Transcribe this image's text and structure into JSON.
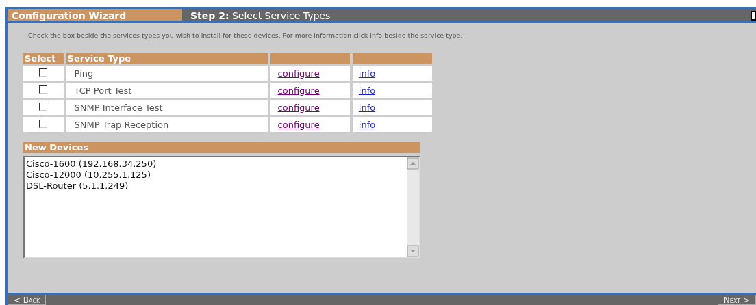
{
  "window": {
    "title": "Configuration Wizard",
    "step": "**Step 2:** Select Service Types"
  },
  "instructions": "Check the box beside the services types you wish to install for these devices. For more information click info beside the service type.",
  "table": {
    "columns": [
      "Select",
      "Service Type"
    ],
    "rows": [
      {
        "checked": false,
        "service": "Ping",
        "configure": "configure",
        "info": "info"
      },
      {
        "checked": false,
        "service": "TCP Port Test",
        "configure": "configure",
        "info": "info"
      },
      {
        "checked": false,
        "service": "SNMP Interface Test",
        "configure": "configure",
        "info": "info"
      },
      {
        "checked": false,
        "service": "SNMP Trap Reception",
        "configure": "configure",
        "info": "info"
      }
    ]
  },
  "new_devices": {
    "title": "New Devices",
    "items": [
      "Cisco-1600 (192.168.34.250)",
      "Cisco-12000 (10.255.1.125)",
      "DSL-Router (5.1.1.249)"
    ]
  },
  "buttons": {
    "back": "< Back",
    "next": "Next >"
  }
}
